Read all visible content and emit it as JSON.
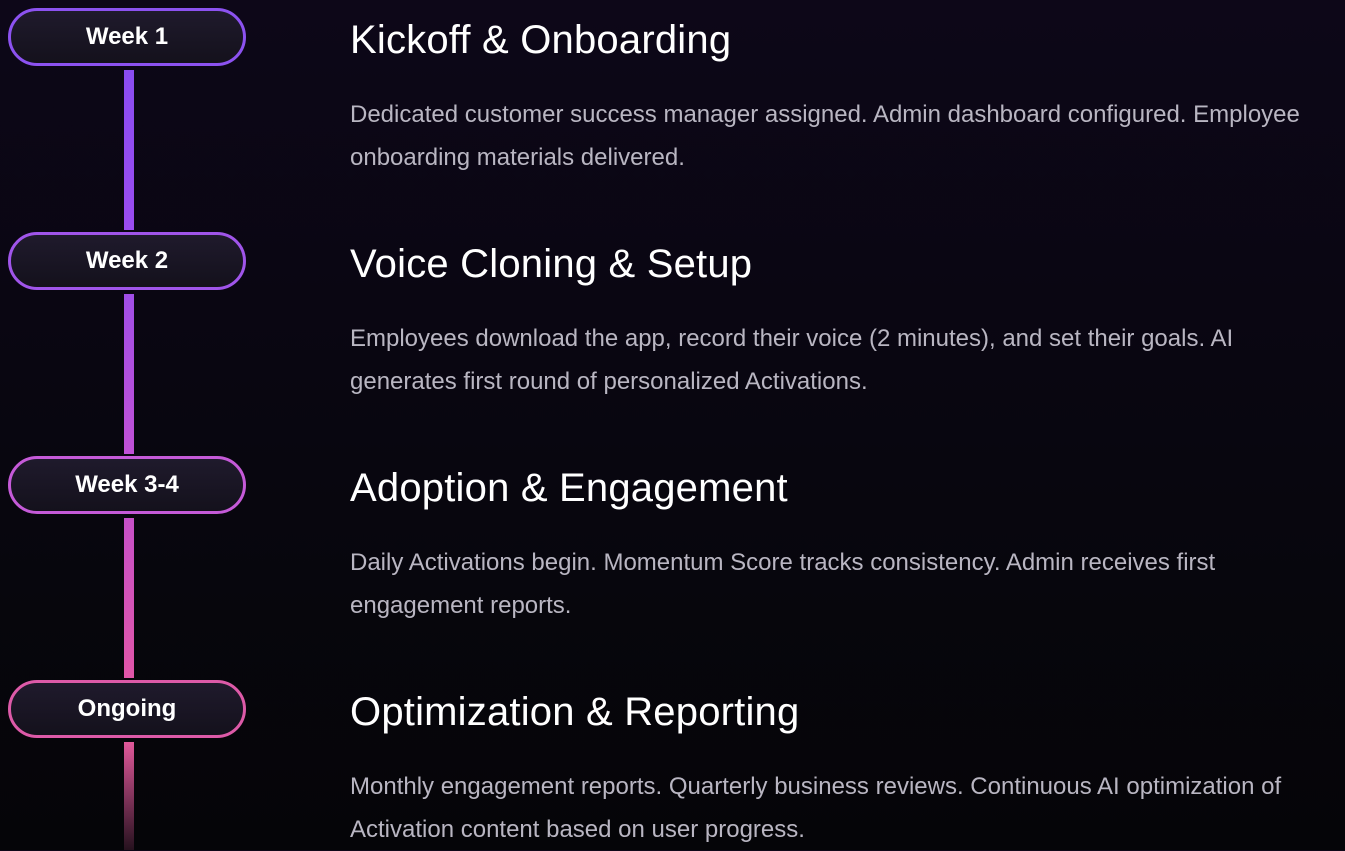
{
  "timeline": {
    "steps": [
      {
        "label": "Week 1",
        "title": "Kickoff & Onboarding",
        "description": "Dedicated customer success manager assigned. Admin dashboard configured. Employee onboarding materials delivered."
      },
      {
        "label": "Week 2",
        "title": "Voice Cloning & Setup",
        "description": "Employees download the app, record their voice (2 minutes), and set their goals. AI generates first round of personalized Activations."
      },
      {
        "label": "Week 3-4",
        "title": "Adoption & Engagement",
        "description": "Daily Activations begin. Momentum Score tracks consistency. Admin receives first engagement reports."
      },
      {
        "label": "Ongoing",
        "title": "Optimization & Reporting",
        "description": "Monthly engagement reports. Quarterly business reviews. Continuous AI optimization of Activation content based on user progress."
      }
    ]
  },
  "colors": {
    "background": "#08060f",
    "accent_purple": "#8c52f0",
    "accent_pink": "#dd5aa8",
    "title_text": "#ffffff",
    "body_text": "#b9b6c2"
  }
}
